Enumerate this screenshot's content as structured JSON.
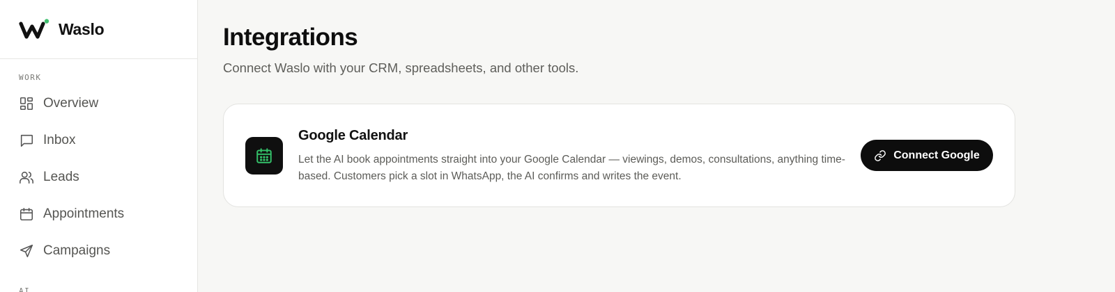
{
  "brand": {
    "name": "Waslo",
    "logo_icon": "waslo-w-logo",
    "accent": "#3fbf6f"
  },
  "sidebar": {
    "sections": [
      {
        "label": "WORK",
        "items": [
          {
            "label": "Overview",
            "icon": "grid-icon"
          },
          {
            "label": "Inbox",
            "icon": "chat-bubble-icon"
          },
          {
            "label": "Leads",
            "icon": "users-icon"
          },
          {
            "label": "Appointments",
            "icon": "calendar-icon"
          },
          {
            "label": "Campaigns",
            "icon": "send-icon"
          }
        ]
      },
      {
        "label": "AI"
      }
    ]
  },
  "main": {
    "title": "Integrations",
    "subtitle": "Connect Waslo with your CRM, spreadsheets, and other tools."
  },
  "integrations": [
    {
      "name": "Google Calendar",
      "icon": "calendar-icon",
      "icon_color": "#34c26a",
      "description": "Let the AI book appointments straight into your Google Calendar — viewings, demos, consultations, anything time-based. Customers pick a slot in WhatsApp, the AI confirms and writes the event.",
      "button_label": "Connect Google",
      "button_icon": "link-icon"
    }
  ]
}
